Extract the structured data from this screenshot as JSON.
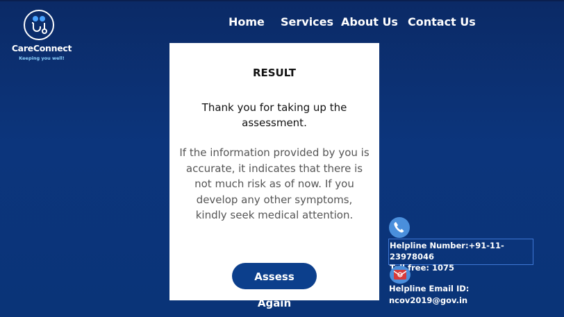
{
  "brand": {
    "name": "CareConnect",
    "tagline": "Keeping you well!"
  },
  "nav": {
    "items": [
      "Home",
      "Services",
      "About Us",
      "Contact Us"
    ]
  },
  "result": {
    "title": "RESULT",
    "thanks": "Thank you for taking up the assessment.",
    "info": "If the information provided by you is accurate, it indicates that there is not much risk as of now. If you develop any other symptoms, kindly seek medical attention.",
    "button_label": "Assess Again"
  },
  "helpline": {
    "number_text": "Helpline Number:+91-11-23978046",
    "tollfree_text": "Toll free: 1075",
    "email_label": "Helpline Email ID:",
    "email_value": "ncov2019@gov.in",
    "phone_icon": "phone-icon",
    "mail_icon": "email-icon"
  },
  "colors": {
    "background": "#0b2a66",
    "button": "#0c3f8c",
    "icon": "#4a8fdc",
    "tagline": "#8fd3ff"
  }
}
